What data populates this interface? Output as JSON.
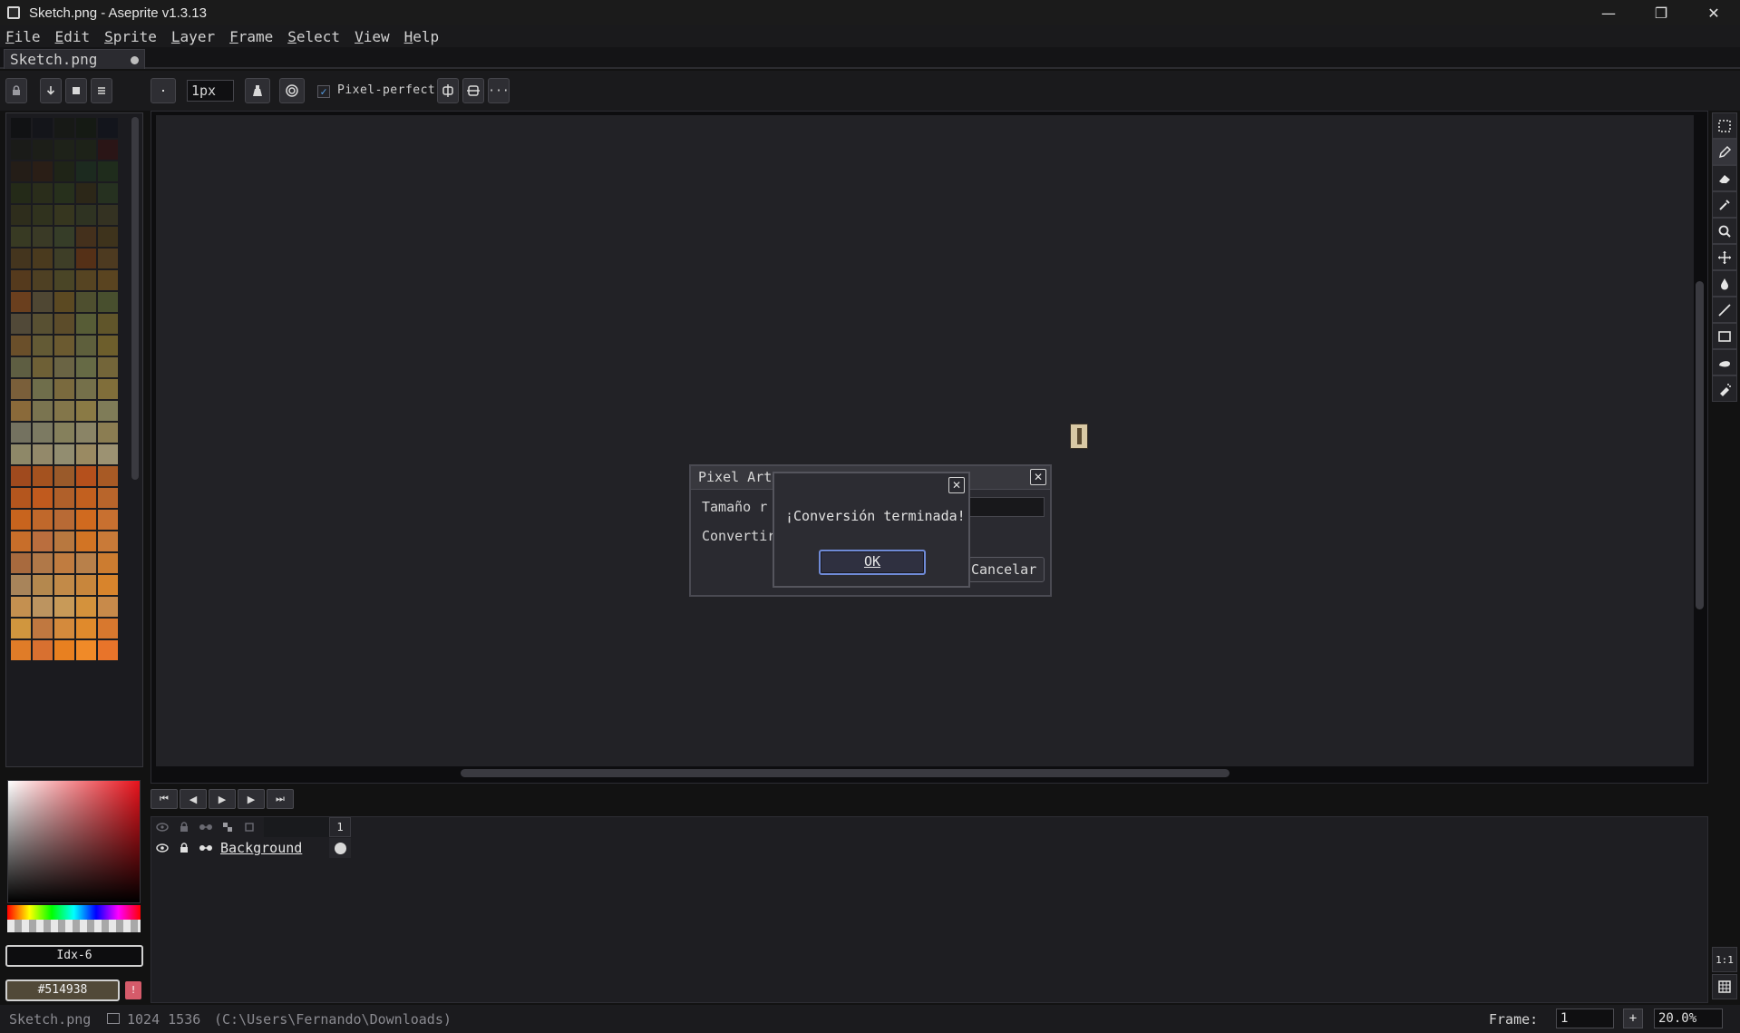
{
  "window": {
    "title": "Sketch.png - Aseprite v1.3.13",
    "controls": {
      "minimize": "—",
      "maximize": "❐",
      "close": "✕"
    }
  },
  "menu": [
    {
      "first": "F",
      "rest": "ile"
    },
    {
      "first": "E",
      "rest": "dit"
    },
    {
      "first": "S",
      "rest": "prite"
    },
    {
      "first": "L",
      "rest": "ayer"
    },
    {
      "first": "F",
      "rest": "rame"
    },
    {
      "first": "S",
      "rest": "elect"
    },
    {
      "first": "V",
      "rest": "iew"
    },
    {
      "first": "H",
      "rest": "elp"
    }
  ],
  "tabs": [
    {
      "label": "Sketch.png"
    }
  ],
  "context_bar": {
    "brush_size": "1px",
    "pixel_perfect_label": "Pixel-perfect",
    "pixel_perfect_checked": "✓",
    "more": "···"
  },
  "palette": {
    "colors": [
      "#111214",
      "#14151a",
      "#171916",
      "#151a14",
      "#13151c",
      "#1a1b18",
      "#1c1e18",
      "#1e2219",
      "#1d2218",
      "#2a1516",
      "#241d17",
      "#2a1e16",
      "#1f2417",
      "#1c2a1f",
      "#1f2c1c",
      "#242a18",
      "#2a2d1b",
      "#27301c",
      "#2c2718",
      "#263120",
      "#2e2d1c",
      "#30321e",
      "#36361f",
      "#2f3322",
      "#343222",
      "#383a23",
      "#3a3a26",
      "#363d28",
      "#44301c",
      "#3e331c",
      "#44351e",
      "#4a3a1e",
      "#3e3e27",
      "#553017",
      "#4d3a20",
      "#553a1d",
      "#4e4023",
      "#4a4526",
      "#564422",
      "#5a4420",
      "#6a3f1e",
      "#4f4733",
      "#5b4922",
      "#4e4f2f",
      "#484f2e",
      "#514938",
      "#585032",
      "#5c4c2a",
      "#575c36",
      "#60552a",
      "#6a4f2a",
      "#635a35",
      "#6b5a30",
      "#5e5f3c",
      "#6d5e2c",
      "#5e5e42",
      "#6e6036",
      "#6a6444",
      "#666a45",
      "#736539",
      "#7a5f3a",
      "#6f6e4b",
      "#7a6a3e",
      "#75704a",
      "#806e3a",
      "#8a6a3a",
      "#7a7450",
      "#83764a",
      "#8a7a45",
      "#7f7c58",
      "#747260",
      "#7c7a62",
      "#85805c",
      "#8a8466",
      "#8b7d52",
      "#8e8868",
      "#93896a",
      "#928d70",
      "#9a8a62",
      "#9c9272",
      "#a04a1e",
      "#a4521f",
      "#9a5a2a",
      "#b5501c",
      "#a85a25",
      "#b4561e",
      "#c05a1e",
      "#b0602a",
      "#c2601f",
      "#b8652b",
      "#c8641e",
      "#c0682b",
      "#b86a35",
      "#d06a1f",
      "#c87030",
      "#c86e2a",
      "#ba6e3e",
      "#b8783f",
      "#d27424",
      "#c97a38",
      "#a86a3e",
      "#b07848",
      "#c07c40",
      "#b8804a",
      "#cc7c30",
      "#a8845a",
      "#b4884e",
      "#c28a48",
      "#c8863c",
      "#d8842c",
      "#c49050",
      "#bc9460",
      "#c89a58",
      "#d4923c",
      "#c88a4a",
      "#d0963e",
      "#c07840",
      "#d48a3c",
      "#e08a2c",
      "#d8782e",
      "#e07c28",
      "#d87030",
      "#e88020",
      "#f08a28",
      "#e8742a"
    ]
  },
  "color": {
    "index": "Idx-6",
    "hex": "#514938",
    "fg_icon": "!"
  },
  "dialog_back": {
    "title": "Pixel Art r",
    "size_label": "Tamaño r",
    "convert_label": "Convertir",
    "cancel": "Cancelar",
    "close": "✕"
  },
  "dialog_front": {
    "message": "¡Conversión terminada!",
    "ok": "OK",
    "close": "✕"
  },
  "animation": {
    "first": "⏮",
    "prev": "◀",
    "play": "▶",
    "next": "▶",
    "last": "⏭"
  },
  "timeline": {
    "frame_number": "1",
    "layers": [
      {
        "name": "Background"
      }
    ]
  },
  "status": {
    "file": "Sketch.png",
    "dims": "1024 1536",
    "path": "(C:\\Users\\Fernando\\Downloads)",
    "frame_label": "Frame:",
    "frame_value": "1",
    "add": "+",
    "zoom": "20.0%"
  },
  "tool_bottom": {
    "one_to_one": "1:1"
  }
}
